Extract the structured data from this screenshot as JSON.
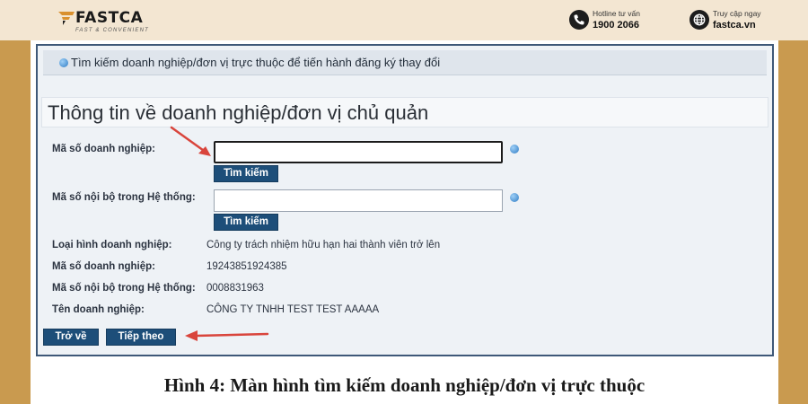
{
  "brand": {
    "name": "FASTCA",
    "tagline": "FAST & CONVENIENT",
    "colors": {
      "banner_bg": "#f3e6d2",
      "page_bg": "#c99a4f",
      "accent": "#d9902e",
      "button": "#1d4e79",
      "arrow": "#d9453c"
    }
  },
  "contacts": {
    "hotline": {
      "icon": "phone-icon",
      "label": "Hotline tư vấn",
      "value": "1900 2066"
    },
    "website": {
      "icon": "globe-icon",
      "label": "Truy cập ngay",
      "value": "fastca.vn"
    }
  },
  "form": {
    "section_title": "Tìm kiếm doanh nghiệp/đơn vị trực thuộc để tiến hành đăng ký thay đổi",
    "subtitle": "Thông tin về doanh nghiệp/đơn vị chủ quản",
    "search_fields": [
      {
        "label": "Mã số doanh nghiệp:",
        "value": "",
        "button": "Tìm kiếm"
      },
      {
        "label": "Mã số nội bộ trong Hệ thống:",
        "value": "",
        "button": "Tìm kiếm"
      }
    ],
    "info_rows": [
      {
        "label": "Loại hình doanh nghiệp:",
        "value": "Công ty trách nhiệm hữu hạn hai thành viên trở lên"
      },
      {
        "label": "Mã số doanh nghiệp:",
        "value": "19243851924385"
      },
      {
        "label": "Mã số nội bộ trong Hệ thống:",
        "value": "0008831963"
      },
      {
        "label": "Tên doanh nghiệp:",
        "value": "CÔNG TY TNHH TEST TEST AAAAA"
      }
    ],
    "actions": {
      "back": "Trở về",
      "next": "Tiếp theo"
    }
  },
  "caption": "Hình 4: Màn hình tìm kiếm doanh nghiệp/đơn vị trực thuộc"
}
